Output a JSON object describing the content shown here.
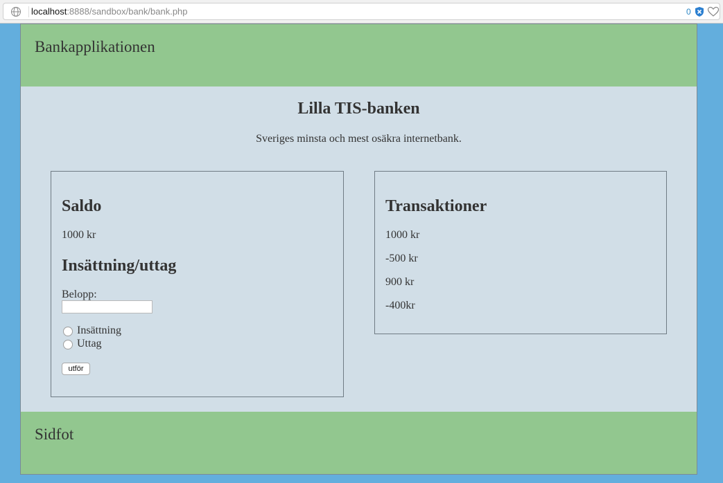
{
  "browser": {
    "url_host": "localhost",
    "url_path": ":8888/sandbox/bank/bank.php",
    "blocked_count": "0"
  },
  "header": {
    "title": "Bankapplikationen"
  },
  "main": {
    "title": "Lilla TIS-banken",
    "subtitle": "Sveriges minsta och mest osäkra internetbank."
  },
  "balance": {
    "heading": "Saldo",
    "value": "1000 kr"
  },
  "transfer": {
    "heading": "Insättning/uttag",
    "amount_label": "Belopp:",
    "amount_value": "",
    "deposit_label": "Insättning",
    "withdraw_label": "Uttag",
    "submit_label": "utför"
  },
  "transactions": {
    "heading": "Transaktioner",
    "items": [
      "1000 kr",
      "-500 kr",
      "900 kr",
      "-400kr"
    ]
  },
  "footer": {
    "title": "Sidfot"
  },
  "colors": {
    "background": "#63aedd",
    "header_footer": "#92c78f",
    "content": "#d1dee7"
  }
}
